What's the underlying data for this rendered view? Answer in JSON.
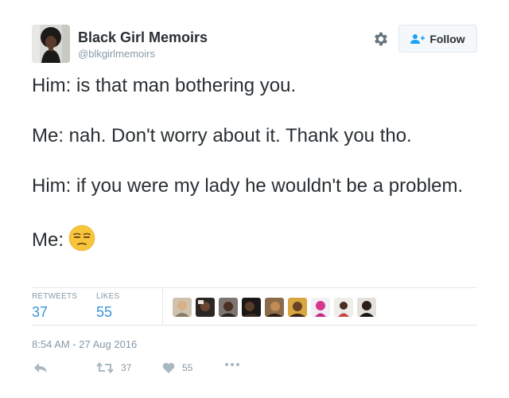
{
  "profile": {
    "name": "Black Girl Memoirs",
    "handle": "@blkgirlmemoirs"
  },
  "header": {
    "settings_icon": "gear-icon",
    "follow_label": "Follow",
    "follow_icon": "add-user-icon"
  },
  "tweet": {
    "lines": [
      "Him: is that man bothering you.",
      "Me: nah. Don't worry about it. Thank you tho.",
      "Him: if you were my lady he wouldn't be a problem.",
      "Me:"
    ],
    "emoji": "unamused-face"
  },
  "stats": {
    "retweets_label": "RETWEETS",
    "retweets_count": "37",
    "likes_label": "LIKES",
    "likes_count": "55"
  },
  "timestamp": "8:54 AM - 27 Aug 2016",
  "actions": {
    "reply_icon": "reply-icon",
    "retweet_icon": "retweet-icon",
    "retweet_count": "37",
    "like_icon": "heart-icon",
    "like_count": "55",
    "more_icon": "more-icon"
  },
  "colors": {
    "text": "#292f33",
    "muted": "#8899a6",
    "accent": "#3b94d9",
    "border": "#e1e8ed"
  }
}
